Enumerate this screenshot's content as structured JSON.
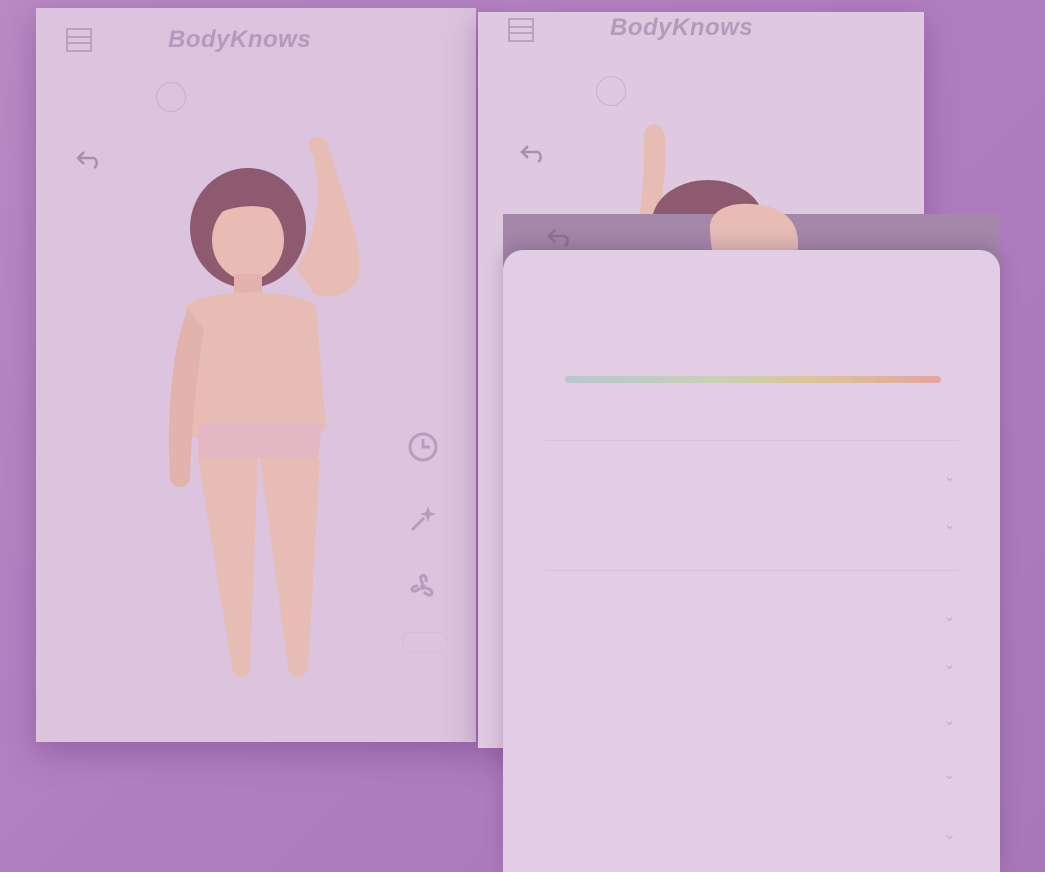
{
  "app": {
    "brand": "BodyKnows"
  },
  "left_panel": {
    "days": [
      "",
      "",
      "",
      "",
      "",
      "",
      "",
      "",
      "",
      ""
    ],
    "body_annotation": "",
    "tools": [
      "clock-icon",
      "spark-icon",
      "fan-icon"
    ]
  },
  "mid_panel": {
    "days": [
      "",
      "",
      "",
      "",
      "",
      "",
      "",
      "",
      "",
      ""
    ]
  },
  "detail": {
    "title": "",
    "close_label": "",
    "scale_low": "",
    "scale_high": "",
    "rows": [
      {
        "label": "",
        "value": ""
      },
      {
        "label": "",
        "value": ""
      },
      {
        "label": "",
        "value": ""
      },
      {
        "label": "",
        "value": ""
      },
      {
        "label": "",
        "value": ""
      },
      {
        "label": "",
        "value": ""
      },
      {
        "label": "",
        "value": ""
      }
    ]
  },
  "colors": {
    "background": "#b07ec0",
    "panel": "#dcc4de",
    "overlay_bar": "#a487a9",
    "skin": "#e2b3ad",
    "hair": "#8e5a6f"
  }
}
